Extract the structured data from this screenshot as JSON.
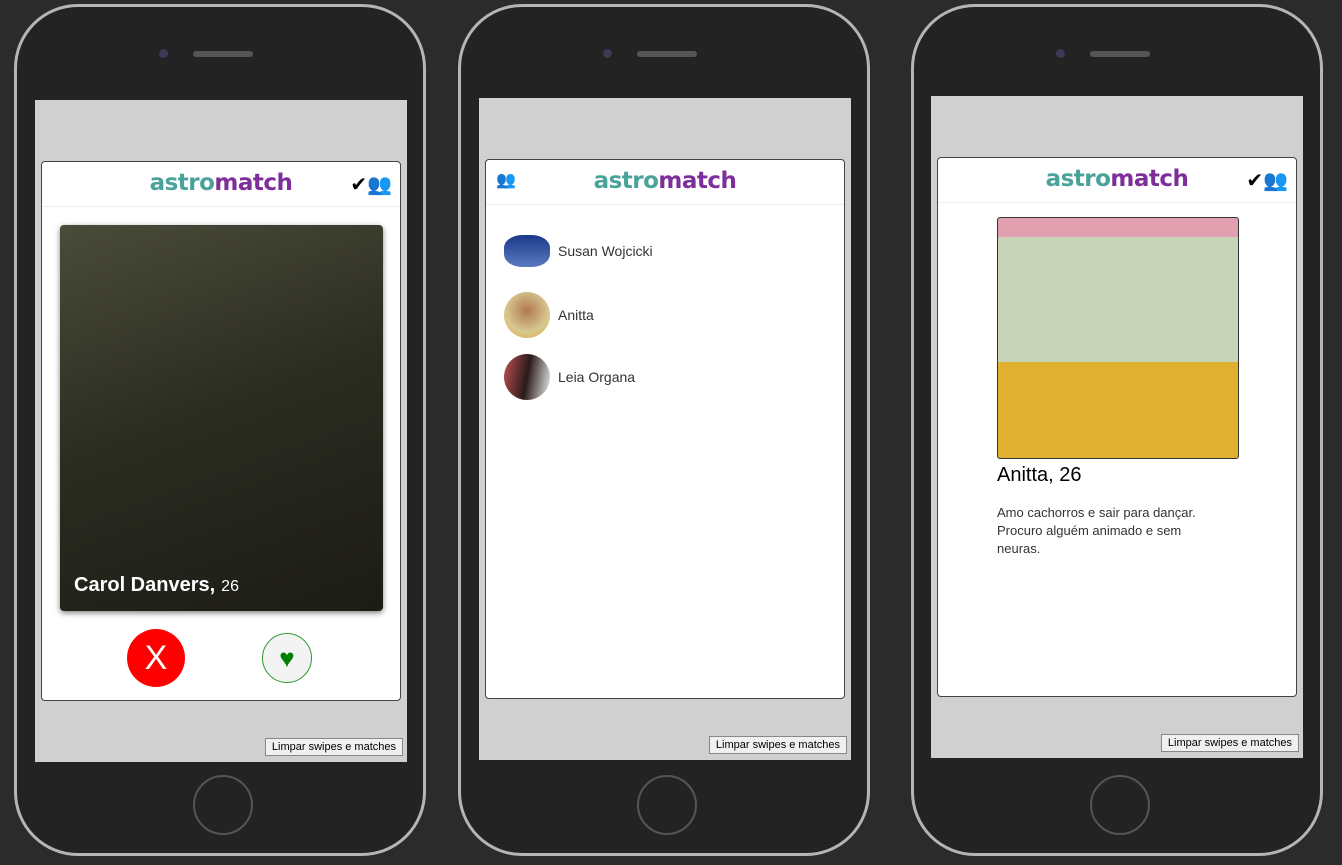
{
  "app": {
    "logo_part1": "astro",
    "logo_part2": "match",
    "clear_label": "Limpar swipes e matches"
  },
  "screen1": {
    "profile_name": "Carol Danvers,",
    "profile_age": "26",
    "reject_label": "X",
    "like_icon": "♥",
    "header_icon": "matches-icon"
  },
  "screen2": {
    "header_icon": "swap-profiles-icon",
    "matches": [
      {
        "name": "Susan Wojcicki"
      },
      {
        "name": "Anitta"
      },
      {
        "name": "Leia Organa"
      }
    ]
  },
  "screen3": {
    "header_icon": "matches-icon",
    "name_age": "Anitta, 26",
    "bio": "Amo cachorros e sair para dançar. Procuro alguém animado e sem neuras."
  },
  "colors": {
    "astro": "#4aa39a",
    "match": "#7d2e9a",
    "reject": "#ff0000",
    "like": "#008000"
  }
}
